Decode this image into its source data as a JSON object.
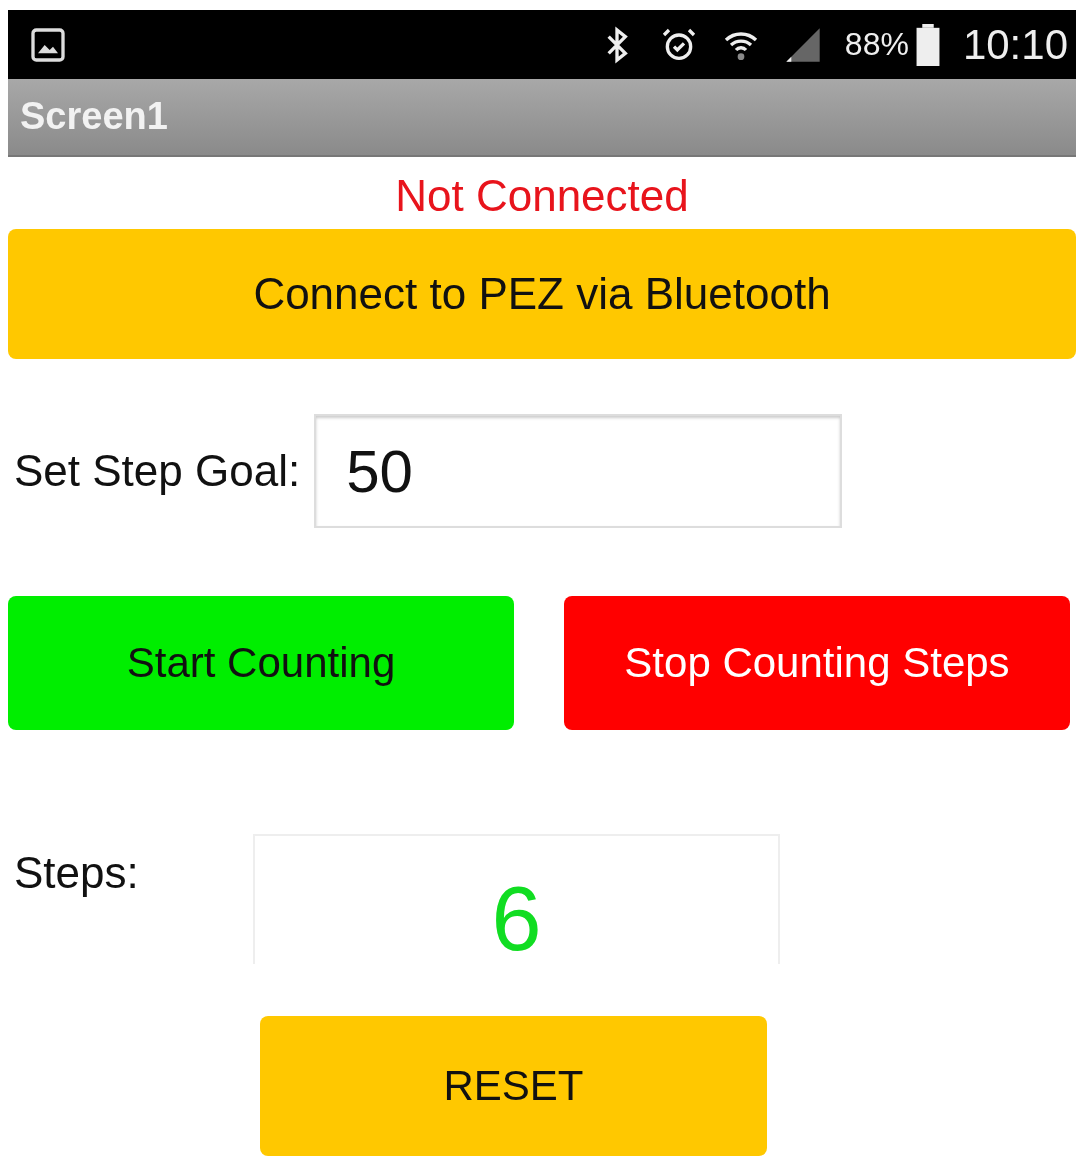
{
  "status_bar": {
    "battery": "88%",
    "time": "10:10"
  },
  "title_bar": {
    "title": "Screen1"
  },
  "connection_status": "Not Connected",
  "connect_button": "Connect to PEZ via Bluetooth",
  "step_goal": {
    "label": "Set Step Goal:",
    "value": "50"
  },
  "buttons": [
    {
      "label": "Start Counting",
      "color": "#00ee00"
    },
    {
      "label": "Stop Counting Steps",
      "color": "#ff0000"
    }
  ],
  "steps": {
    "label": "Steps:",
    "value": "6"
  },
  "reset_button": "RESET"
}
